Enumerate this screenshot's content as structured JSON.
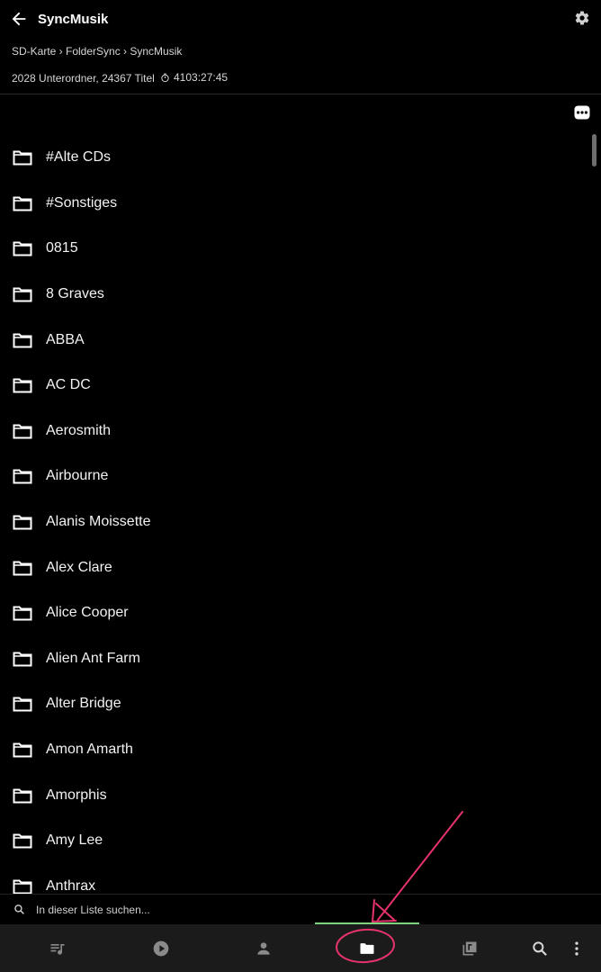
{
  "header": {
    "title": "SyncMusik",
    "breadcrumb": "SD-Karte › FolderSync › SyncMusik",
    "stats": "2028 Unterordner, 24367 Titel",
    "duration": "4103:27:45",
    "icons": {
      "back": "arrow-left-icon",
      "settings": "gear-icon",
      "more": "more-options-icon",
      "duration": "timer-icon"
    }
  },
  "folders": [
    "#Alte CDs",
    "#Sonstiges",
    "0815",
    "8 Graves",
    "ABBA",
    "AC DC",
    "Aerosmith",
    "Airbourne",
    "Alanis Moissette",
    "Alex Clare",
    "Alice Cooper",
    "Alien Ant Farm",
    "Alter Bridge",
    "Amon Amarth",
    "Amorphis",
    "Amy Lee",
    "Anthrax"
  ],
  "search": {
    "placeholder": "In dieser Liste suchen..."
  },
  "nav": {
    "items": [
      "queue-music-icon",
      "play-circle-icon",
      "person-icon",
      "folder-icon",
      "album-icon",
      "search-icon",
      "more-vert-icon"
    ],
    "active": "folder-icon"
  },
  "colors": {
    "background": "#000000",
    "navbar": "#1b1b1b",
    "accent": "#7ed37e",
    "annotation": "#e6336b"
  }
}
